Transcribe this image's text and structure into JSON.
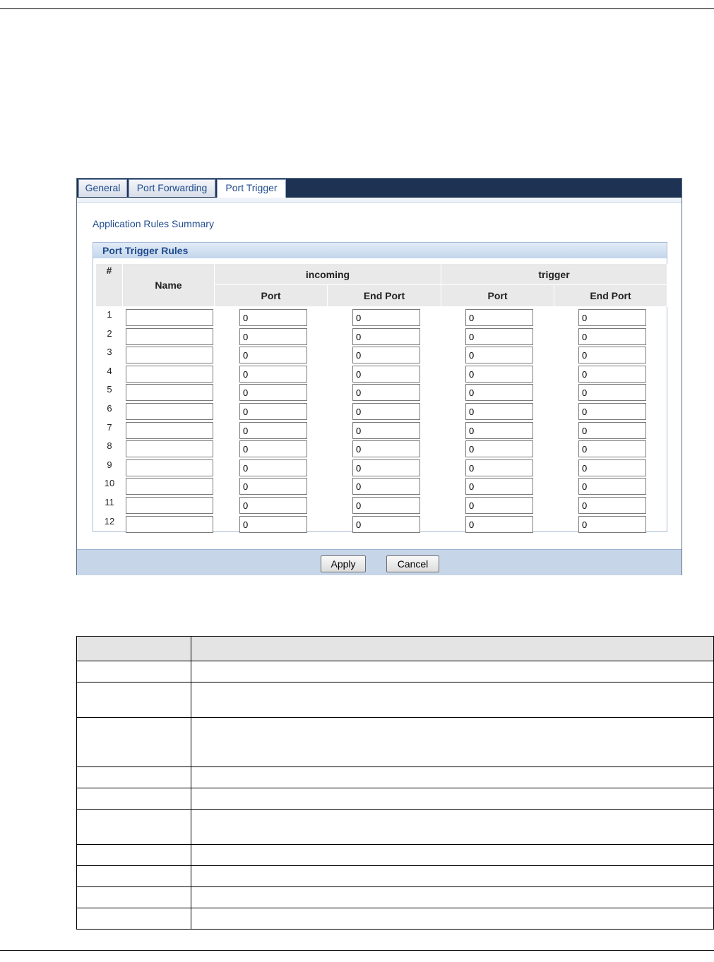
{
  "tabs": [
    {
      "label": "General"
    },
    {
      "label": "Port Forwarding"
    },
    {
      "label": "Port Trigger"
    }
  ],
  "summary_title": "Application Rules Summary",
  "rules_title": "Port Trigger Rules",
  "table": {
    "col_num": "#",
    "col_name": "Name",
    "group_incoming": "incoming",
    "group_trigger": "trigger",
    "col_port": "Port",
    "col_end_port": "End Port"
  },
  "rows": [
    {
      "num": "1",
      "name": "",
      "in_port": "0",
      "in_end": "0",
      "tr_port": "0",
      "tr_end": "0"
    },
    {
      "num": "2",
      "name": "",
      "in_port": "0",
      "in_end": "0",
      "tr_port": "0",
      "tr_end": "0"
    },
    {
      "num": "3",
      "name": "",
      "in_port": "0",
      "in_end": "0",
      "tr_port": "0",
      "tr_end": "0"
    },
    {
      "num": "4",
      "name": "",
      "in_port": "0",
      "in_end": "0",
      "tr_port": "0",
      "tr_end": "0"
    },
    {
      "num": "5",
      "name": "",
      "in_port": "0",
      "in_end": "0",
      "tr_port": "0",
      "tr_end": "0"
    },
    {
      "num": "6",
      "name": "",
      "in_port": "0",
      "in_end": "0",
      "tr_port": "0",
      "tr_end": "0"
    },
    {
      "num": "7",
      "name": "",
      "in_port": "0",
      "in_end": "0",
      "tr_port": "0",
      "tr_end": "0"
    },
    {
      "num": "8",
      "name": "",
      "in_port": "0",
      "in_end": "0",
      "tr_port": "0",
      "tr_end": "0"
    },
    {
      "num": "9",
      "name": "",
      "in_port": "0",
      "in_end": "0",
      "tr_port": "0",
      "tr_end": "0"
    },
    {
      "num": "10",
      "name": "",
      "in_port": "0",
      "in_end": "0",
      "tr_port": "0",
      "tr_end": "0"
    },
    {
      "num": "11",
      "name": "",
      "in_port": "0",
      "in_end": "0",
      "tr_port": "0",
      "tr_end": "0"
    },
    {
      "num": "12",
      "name": "",
      "in_port": "0",
      "in_end": "0",
      "tr_port": "0",
      "tr_end": "0"
    }
  ],
  "buttons": {
    "apply": "Apply",
    "cancel": "Cancel"
  },
  "colors": {
    "tab_bar": "#1e3354",
    "accent_text": "#1f4b8c",
    "bottom_bar": "#c6d5e8"
  }
}
